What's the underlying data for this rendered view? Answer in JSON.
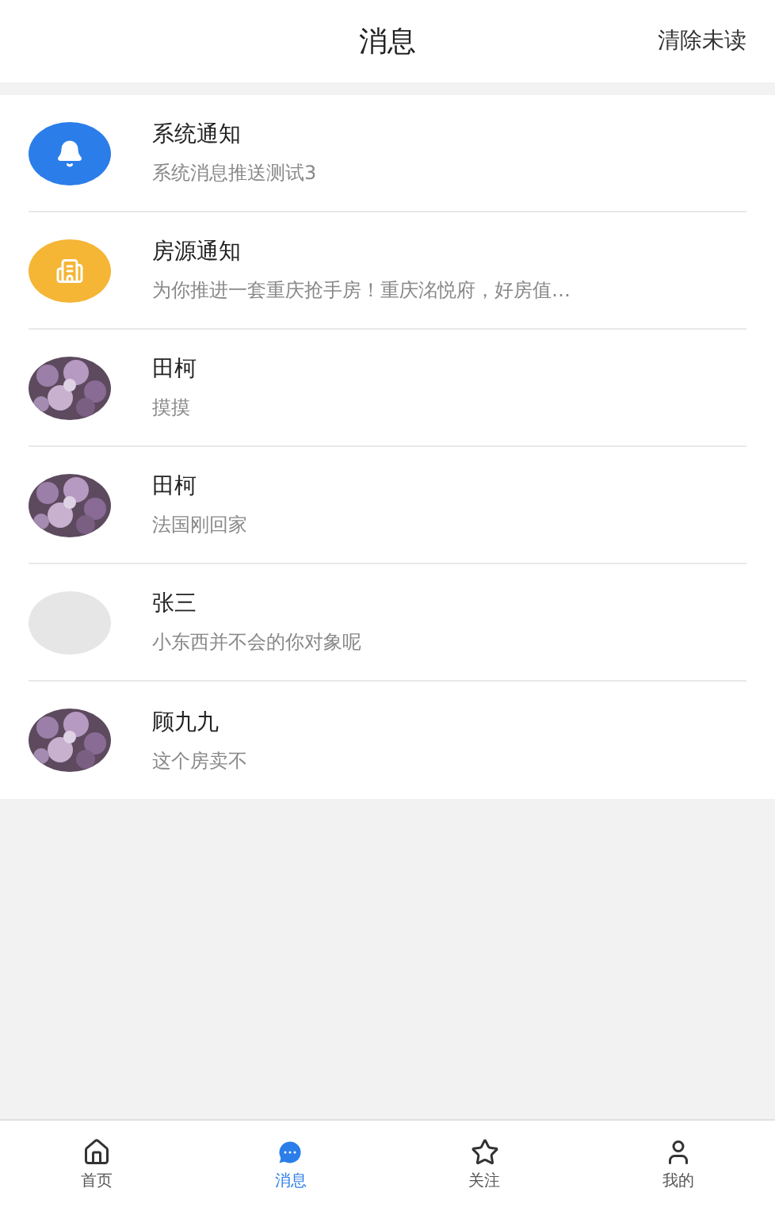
{
  "header": {
    "title": "消息",
    "action": "清除未读"
  },
  "messages": [
    {
      "kind": "bell",
      "name": "系统通知",
      "preview": "系统消息推送测试3"
    },
    {
      "kind": "building",
      "name": "房源通知",
      "preview": "为你推进一套重庆抢手房！重庆洺悦府，好房值…"
    },
    {
      "kind": "picture",
      "name": "田柯",
      "preview": "摸摸"
    },
    {
      "kind": "picture",
      "name": "田柯",
      "preview": "法国刚回家"
    },
    {
      "kind": "blank",
      "name": "张三",
      "preview": "小东西并不会的你对象呢"
    },
    {
      "kind": "picture",
      "name": "顾九九",
      "preview": "这个房卖不"
    }
  ],
  "tabs": [
    {
      "label": "首页",
      "selected": false
    },
    {
      "label": "消息",
      "selected": true
    },
    {
      "label": "关注",
      "selected": false
    },
    {
      "label": "我的",
      "selected": false
    }
  ]
}
